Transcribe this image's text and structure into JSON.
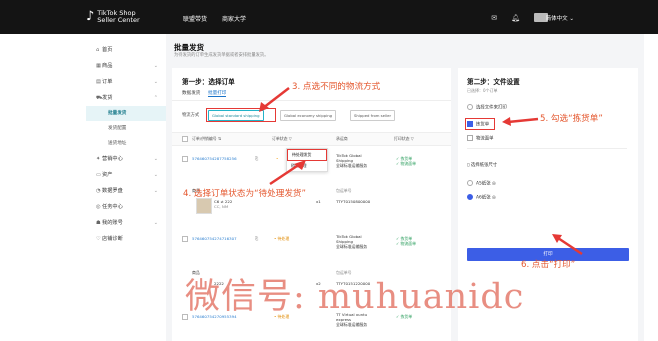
{
  "topbar": {
    "logo_brand": "TikTok Shop",
    "logo_sub": "Seller Center",
    "nav": [
      "联盟带货",
      "商家大学"
    ],
    "lang": "简体中文"
  },
  "sidebar": {
    "items": [
      {
        "icon": "home-icon",
        "label": "首页"
      },
      {
        "icon": "product-icon",
        "label": "商品",
        "chevron": true
      },
      {
        "icon": "order-icon",
        "label": "订单",
        "chevron": true
      },
      {
        "icon": "shipping-icon",
        "label": "发货",
        "chevron": true,
        "expanded": true
      }
    ],
    "subitems": [
      "批量发货",
      "发货配置",
      "送货地址"
    ],
    "items2": [
      {
        "icon": "marketing-icon",
        "label": "营销中心",
        "chevron": true
      },
      {
        "icon": "finance-icon",
        "label": "资产",
        "chevron": true
      },
      {
        "icon": "data-icon",
        "label": "数据罗盘",
        "chevron": true
      },
      {
        "icon": "task-icon",
        "label": "任务中心"
      },
      {
        "icon": "account-icon",
        "label": "我的账号",
        "chevron": true
      },
      {
        "icon": "health-icon",
        "label": "店铺诊断"
      }
    ]
  },
  "page": {
    "title": "批量发货",
    "subtitle": "为待发货的订单生成发货单据或者安排批量发货。"
  },
  "step1": {
    "title": "第一步：选择订单",
    "tabs": [
      "数据发货",
      "批量打印"
    ],
    "logistics_label": "物流方式",
    "logistics_options": [
      "Global standard shipping",
      "Global economy shipping",
      "Shipped from seller"
    ],
    "headers": [
      "订单/供销编号 ⇅",
      "订单状态 ▽",
      "承运商",
      "打印状态 ▽"
    ],
    "status_menu": [
      "待处理发货",
      "稍后处理"
    ],
    "rows": [
      {
        "order": "576460754287758256",
        "carrier": [
          "TikTok Global",
          "Shipping",
          "全球标准运输服务"
        ],
        "print": [
          "✓ 拣货单",
          "✓ 物流面单"
        ]
      },
      {
        "product_label": "商品",
        "product_name": "C6 ≠ 222",
        "product_spec": "CC, NM",
        "qty": "x1",
        "track_label": "包运单号",
        "track": "TTYT0150800000"
      },
      {
        "order": "576460754274716307",
        "status": "• 待处理",
        "carrier": [
          "TikTok Global",
          "Shipping",
          "全球标准运输服务"
        ],
        "print": [
          "✓ 拣货单",
          "✓ 物流面单"
        ]
      },
      {
        "product_label": "商品",
        "product_name": "2222",
        "qty": "x2",
        "track_label": "包运单号",
        "track": "TTYT0151220000"
      },
      {
        "order": "576460754270955394",
        "status": "• 待处理",
        "carrier": [
          "TT Virtual xuntu",
          "express",
          "全球标准运输服务"
        ],
        "print": [
          "✓ 拣货单"
        ]
      }
    ]
  },
  "step2": {
    "title": "第二步：文件设置",
    "selected": "已选择：0个订单",
    "doc_label": "选择文件来打印",
    "doc_options": [
      {
        "label": "拣货单",
        "checked": true
      },
      {
        "label": "物流面单",
        "checked": false
      }
    ],
    "size_label": "选择纸张尺寸",
    "size_options": [
      {
        "label": "A5纸张 ◎",
        "checked": false
      },
      {
        "label": "A6纸张 ◎",
        "checked": true
      }
    ],
    "print_button": "打印"
  },
  "annotations": {
    "a3": "3. 点选不同的物流方式",
    "a4": "4. 选择订单状态为“待处理发货”",
    "a5": "5. 勾选“拣货单”",
    "a6": "6. 点击“打印”"
  },
  "watermark": "微信号: muhuanidc",
  "colors": {
    "accent": "#3c5ee6",
    "annotation": "#e4572e",
    "topbar": "#141414",
    "teal": "#23b3c9"
  }
}
